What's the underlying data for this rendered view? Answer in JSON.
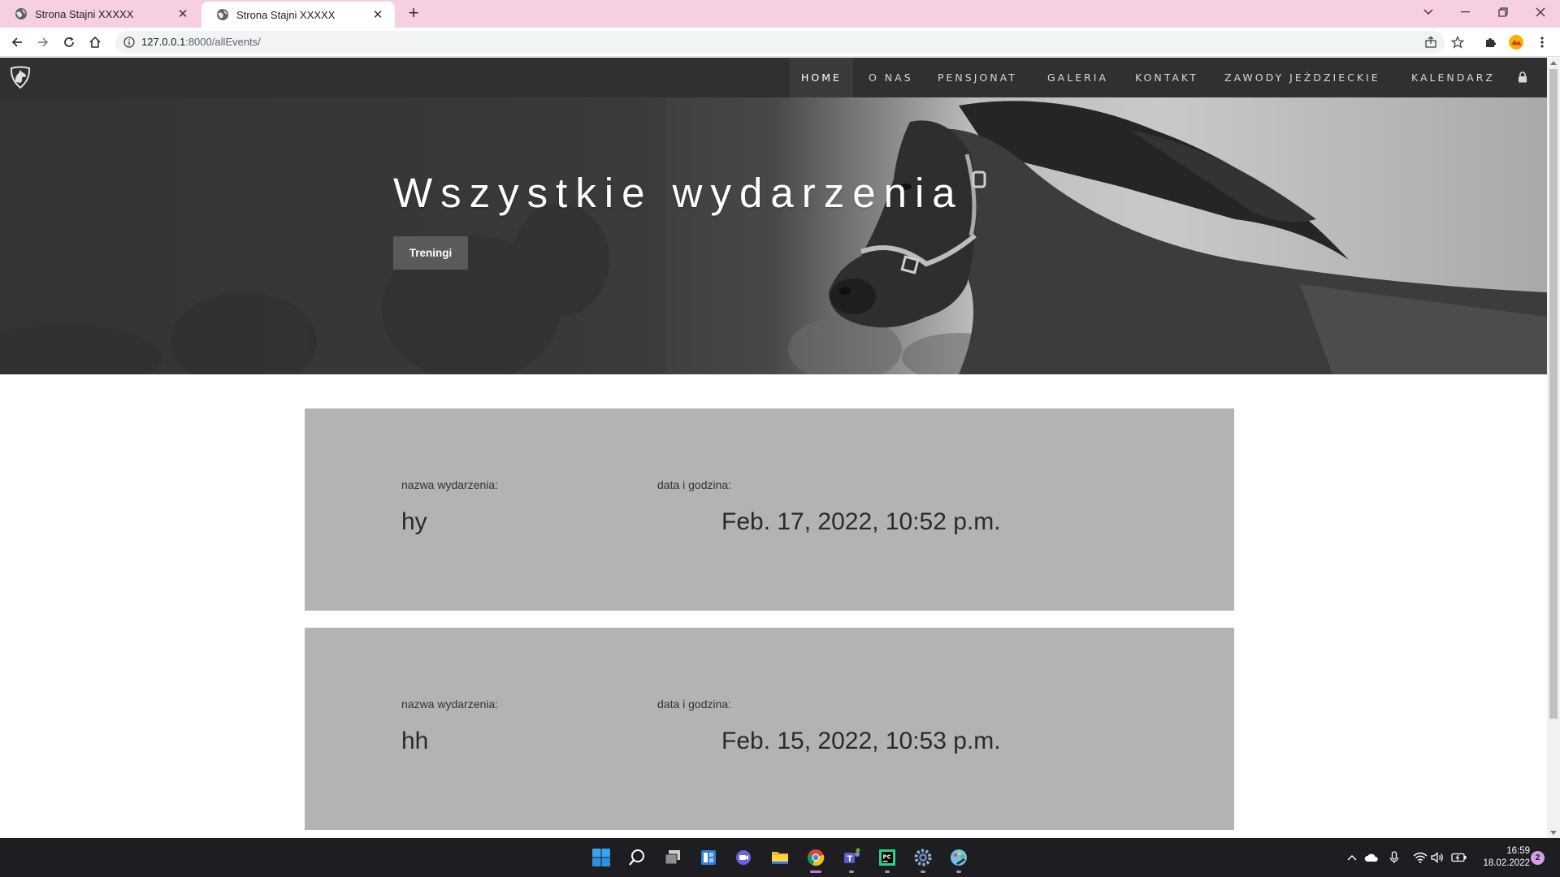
{
  "browser": {
    "tabs": [
      {
        "title": "Strona Stajni XXXXX",
        "active": false
      },
      {
        "title": "Strona Stajni XXXXX",
        "active": true
      }
    ],
    "address": {
      "host": "127.0.0.1",
      "path": ":8000/allEvents/"
    }
  },
  "site": {
    "nav": [
      "HOME",
      "O NAS",
      "PENSJONAT",
      "GALERIA",
      "KONTAKT",
      "ZAWODY JEŹDZIECKIE",
      "KALENDARZ"
    ],
    "active_nav": "HOME",
    "hero": {
      "title": "Wszystkie wydarzenia",
      "button": "Treningi"
    },
    "events": [
      {
        "name_label": "nazwa wydarzenia:",
        "date_label": "data i godzina:",
        "name": "hy",
        "datetime": "Feb. 17, 2022, 10:52 p.m."
      },
      {
        "name_label": "nazwa wydarzenia:",
        "date_label": "data i godzina:",
        "name": "hh",
        "datetime": "Feb. 15, 2022, 10:53 p.m."
      }
    ]
  },
  "taskbar": {
    "apps": [
      "start-icon",
      "search-icon",
      "task-view-icon",
      "widgets-icon",
      "chat-icon",
      "file-explorer-icon",
      "chrome-icon",
      "teams-icon",
      "pycharm-icon",
      "settings-icon",
      "paint-icon"
    ],
    "time": "16:59",
    "date": "18.02.2022",
    "notifications": "2"
  },
  "colors": {
    "tabbar": "#f6cfe0",
    "site_nav": "#303030",
    "event_card": "#b4b3b1",
    "taskbar": "#1d1d22"
  }
}
